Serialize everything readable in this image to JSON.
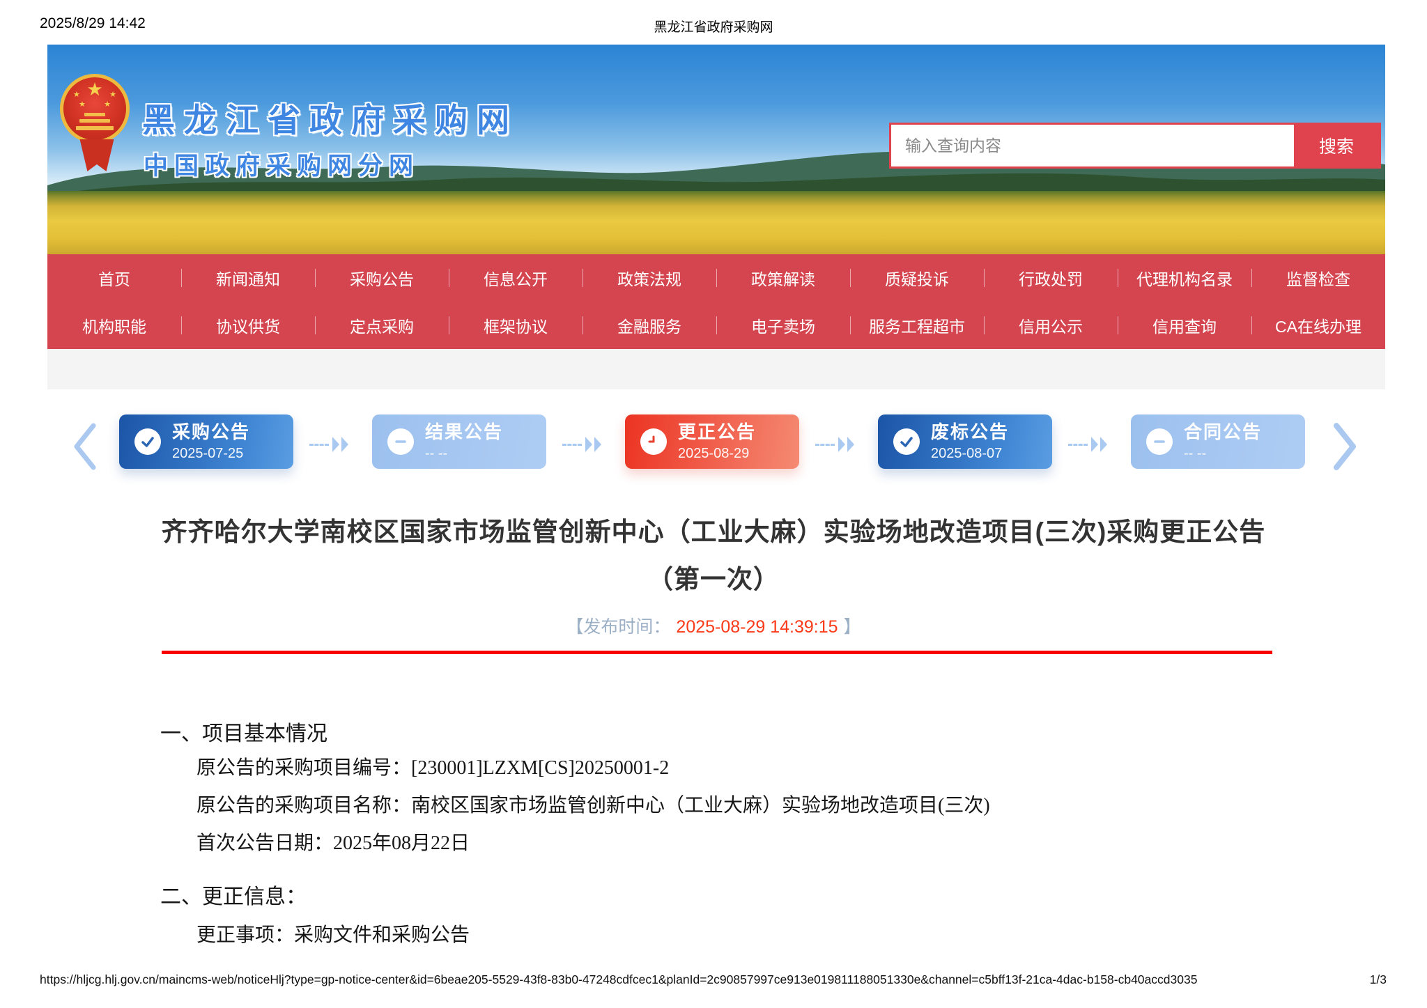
{
  "print_header": {
    "datetime": "2025/8/29 14:42",
    "title": "黑龙江省政府采购网"
  },
  "banner": {
    "site_title": "黑龙江省政府采购网",
    "site_subtitle": "中国政府采购网分网",
    "search": {
      "placeholder": "输入查询内容",
      "button_label": "搜索"
    }
  },
  "nav": {
    "row1": [
      "首页",
      "新闻通知",
      "采购公告",
      "信息公开",
      "政策法规",
      "政策解读",
      "质疑投诉",
      "行政处罚",
      "代理机构名录",
      "监督检查"
    ],
    "row2": [
      "机构职能",
      "协议供货",
      "定点采购",
      "框架协议",
      "金融服务",
      "电子卖场",
      "服务工程超市",
      "信用公示",
      "信用查询",
      "CA在线办理"
    ]
  },
  "timeline": {
    "cards": [
      {
        "label": "采购公告",
        "date": "2025-07-25",
        "state": "done",
        "icon": "check-icon"
      },
      {
        "label": "结果公告",
        "date": "-- --",
        "state": "pending",
        "icon": "minus-icon"
      },
      {
        "label": "更正公告",
        "date": "2025-08-29",
        "state": "current",
        "icon": "clock-icon"
      },
      {
        "label": "废标公告",
        "date": "2025-08-07",
        "state": "done",
        "icon": "check-icon"
      },
      {
        "label": "合同公告",
        "date": "-- --",
        "state": "pending",
        "icon": "minus-icon"
      }
    ]
  },
  "notice": {
    "title": "齐齐哈尔大学南校区国家市场监管创新中心（工业大麻）实验场地改造项目(三次)采购更正公告（第一次）",
    "publish_open": "【发布时间：",
    "publish_time": "2025-08-29 14:39:15",
    "publish_close": "】"
  },
  "content": {
    "section1_heading": "一、项目基本情况",
    "section1_lines": [
      "原公告的采购项目编号：[230001]LZXM[CS]20250001-2",
      "原公告的采购项目名称：南校区国家市场监管创新中心（工业大麻）实验场地改造项目(三次)",
      "首次公告日期：2025年08月22日"
    ],
    "section2_heading": "二、更正信息：",
    "section2_lines": [
      "更正事项：采购文件和采购公告"
    ]
  },
  "footer": {
    "url": "https://hljcg.hlj.gov.cn/maincms-web/noticeHlj?type=gp-notice-center&id=6beae205-5529-43f8-83b0-47248cdfcec1&planId=2c90857997ce913e019811188051330e&channel=c5bff13f-21ca-4dac-b158-cb40accd3035",
    "page_indicator": "1/3"
  },
  "colors": {
    "nav_red": "#d5454f",
    "search_red": "#e0434d",
    "card_blue": "#2b66b5",
    "card_light_blue": "#a5c7f2",
    "card_red": "#ec3322",
    "publish_time_red": "#fb3a17",
    "rule_red": "#f60000",
    "banner_title_blue": "#3f86e2"
  }
}
